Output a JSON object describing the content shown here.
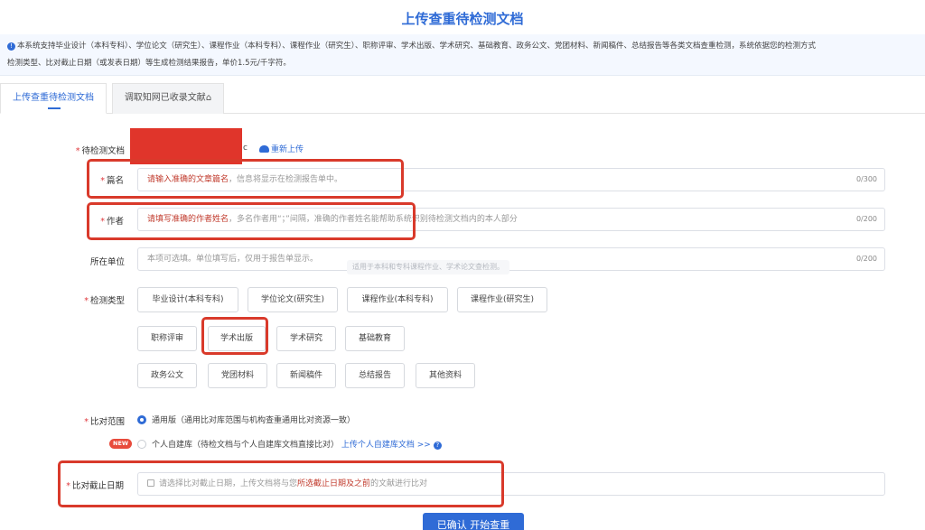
{
  "page": {
    "title": "上传查重待检测文档"
  },
  "notice": {
    "line1": "本系统支持毕业设计（本科专科）、学位论文（研究生）、课程作业（本科专科）、课程作业（研究生）、职称评审、学术出版、学术研究、基础教育、政务公文、党团材料、新闻稿件、总结报告等各类文档查重检测，系统依据您的检测方式",
    "line2": "检测类型、比对截止日期（或发表日期）等生成检测结果报告，单价1.5元/千字符。"
  },
  "tabs": [
    {
      "label": "上传查重待检测文档"
    },
    {
      "label": "调取知网已收录文献"
    }
  ],
  "form": {
    "doc_label": "待检测文档",
    "doc_suffix": "c",
    "reupload_label": "重新上传",
    "title_label": "篇名",
    "title_placeholder_em": "请输入准确的文章篇名",
    "title_placeholder_rest": "，信息将显示在检测报告单中。",
    "title_counter": "0/300",
    "author_label": "作者",
    "author_placeholder_em": "请填写准确的作者姓名",
    "author_placeholder_rest": "，多名作者用“；”间隔，准确的作者姓名能帮助系统识别待检测文档内的本人部分",
    "author_counter": "0/200",
    "unit_label": "所在单位",
    "unit_placeholder": "本项可选填。单位填写后，仅用于报告单显示。",
    "unit_counter": "0/200",
    "unit_tooltip": "适用于本科和专科课程作业、学术论文查检测。",
    "type_label": "检测类型",
    "types": [
      "毕业设计(本科专科)",
      "学位论文(研究生)",
      "课程作业(本科专科)",
      "课程作业(研究生)",
      "职称评审",
      "学术出版",
      "学术研究",
      "基础教育",
      "政务公文",
      "党团材料",
      "新闻稿件",
      "总结报告",
      "其他资料"
    ],
    "range_label": "比对范围",
    "range_option1": "通用版（通用比对库范围与机构查重通用比对资源一致）",
    "new_badge": "NEW",
    "range_option2": "个人自建库（待检文档与个人自建库文档直接比对）",
    "range_option2_link": "上传个人自建库文档 >>",
    "deadline_label": "比对截止日期",
    "deadline_placeholder_a": "请选择比对截止日期，上传文档将与您",
    "deadline_placeholder_em": "所选截止日期及之前",
    "deadline_placeholder_b": "的文献进行比对",
    "submit_label": "已确认 开始查重"
  },
  "colors": {
    "brand": "#2f6bd6",
    "highlight_box": "#d93a2b",
    "required": "#e0393e"
  }
}
